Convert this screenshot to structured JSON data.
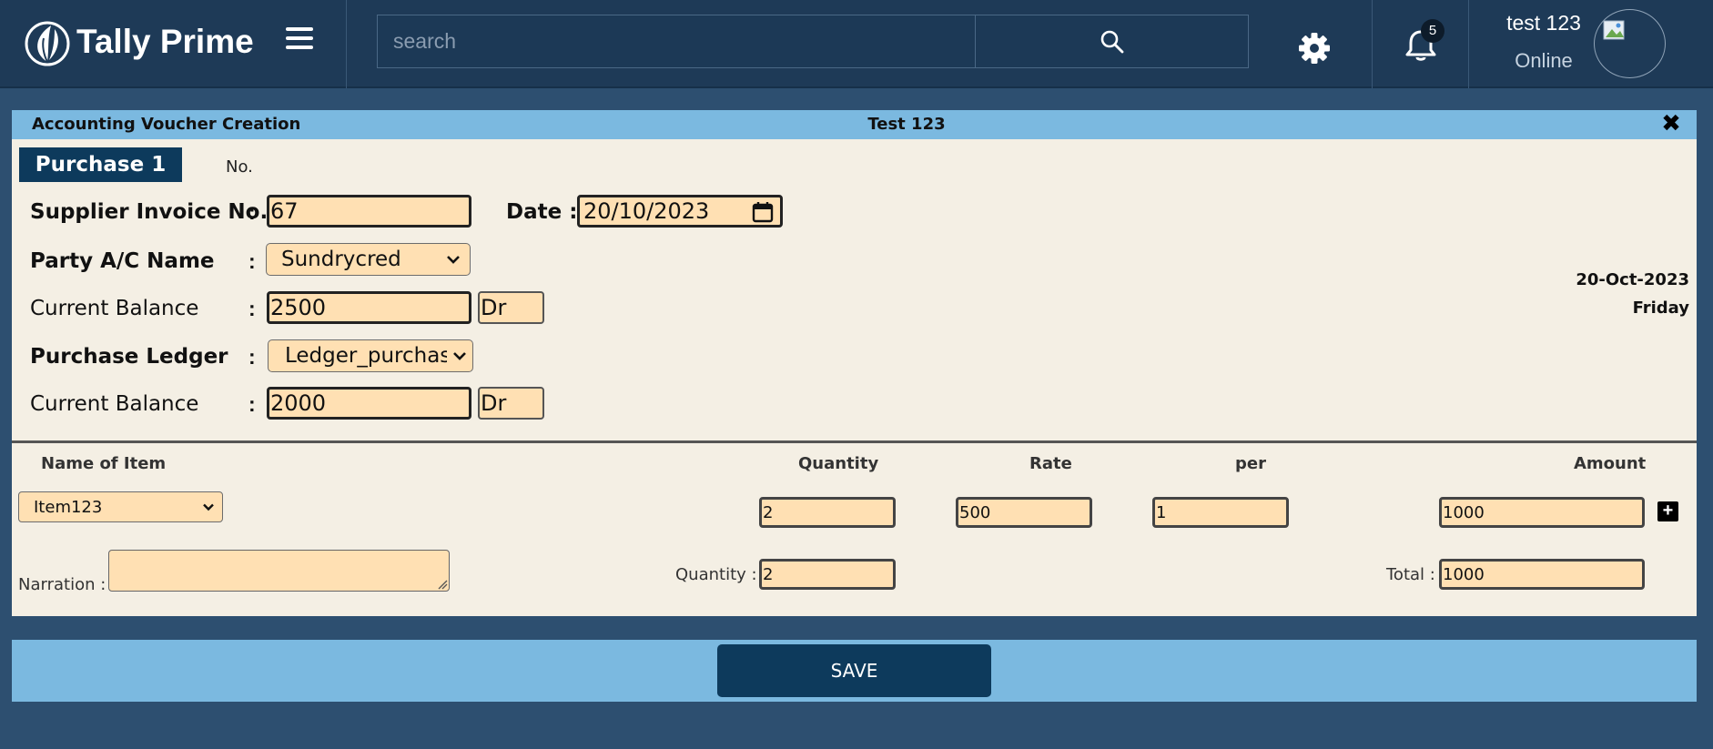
{
  "header": {
    "brand": "Tally Prime",
    "search_placeholder": "search",
    "notification_count": "5",
    "user_name": "test 123",
    "user_status": "Online"
  },
  "voucher": {
    "title": "Accounting Voucher Creation",
    "company": "Test 123",
    "close_glyph": "✖",
    "voucher_type": "Purchase 1",
    "no_label": "No.",
    "supplier_invoice_label": "Supplier Invoice No.",
    "supplier_invoice_value": "67",
    "date_label": "Date :",
    "date_value": "20/10/2023",
    "party_label": "Party A/C Name",
    "party_value": "Sundrycred",
    "party_balance_label": "Current Balance",
    "party_balance_value": "2500",
    "party_balance_type": "Dr",
    "purchase_ledger_label": "Purchase Ledger",
    "purchase_ledger_value": "Ledger_purchas­",
    "ledger_balance_label": "Current Balance",
    "ledger_balance_value": "2000",
    "ledger_balance_type": "Dr",
    "colon": ":",
    "side_date": "20-Oct-2023",
    "side_day": "Friday"
  },
  "items": {
    "columns": {
      "name": "Name of Item",
      "quantity": "Quantity",
      "rate": "Rate",
      "per": "per",
      "amount": "Amount"
    },
    "row": {
      "name": "Item123",
      "quantity": "2",
      "rate": "500",
      "per": "1",
      "amount": "1000"
    },
    "add_glyph": "+",
    "narration_label": "Narration :",
    "quantity_label": "Quantity :",
    "total_quantity": "2",
    "total_label": "Total :",
    "total_amount": "1000"
  },
  "actions": {
    "save_label": "SAVE"
  },
  "colors": {
    "topbar": "#1e3a57",
    "background": "#2d4f70",
    "panel": "#f4efe4",
    "panel_header": "#7bb9e0",
    "field": "#ffe0b3",
    "button": "#0d3a5c"
  },
  "icons": {
    "brand": "leaf-logo-icon",
    "menu": "hamburger-menu-icon",
    "search": "search-icon",
    "settings": "gear-icon",
    "notifications": "bell-icon",
    "avatar": "avatar-broken-image-icon",
    "calendar": "calendar-icon",
    "dropdown": "chevron-down-icon"
  }
}
